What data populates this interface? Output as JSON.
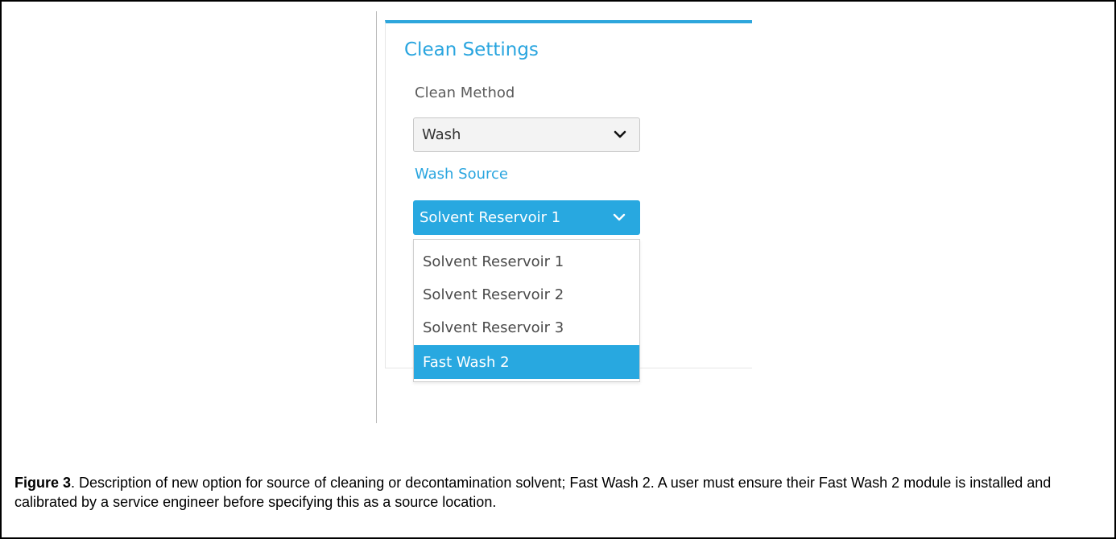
{
  "panel": {
    "title": "Clean Settings",
    "accent_color": "#29a5df"
  },
  "clean_method": {
    "label": "Clean Method",
    "selected": "Wash",
    "icon": "chevron-down-icon"
  },
  "wash_source": {
    "label": "Wash Source",
    "selected": "Solvent Reservoir 1",
    "icon": "chevron-down-icon",
    "options": [
      {
        "label": "Solvent Reservoir 1",
        "highlighted": false
      },
      {
        "label": "Solvent Reservoir 2",
        "highlighted": false
      },
      {
        "label": "Solvent Reservoir 3",
        "highlighted": false
      },
      {
        "label": "Fast Wash 2",
        "highlighted": true
      }
    ]
  },
  "caption": {
    "figure_label": "Figure 3",
    "text": ". Description of new option for source of cleaning or decontamination solvent; Fast Wash 2. A user must ensure their Fast Wash 2 module is installed and calibrated by a service engineer before specifying this as a source location."
  }
}
